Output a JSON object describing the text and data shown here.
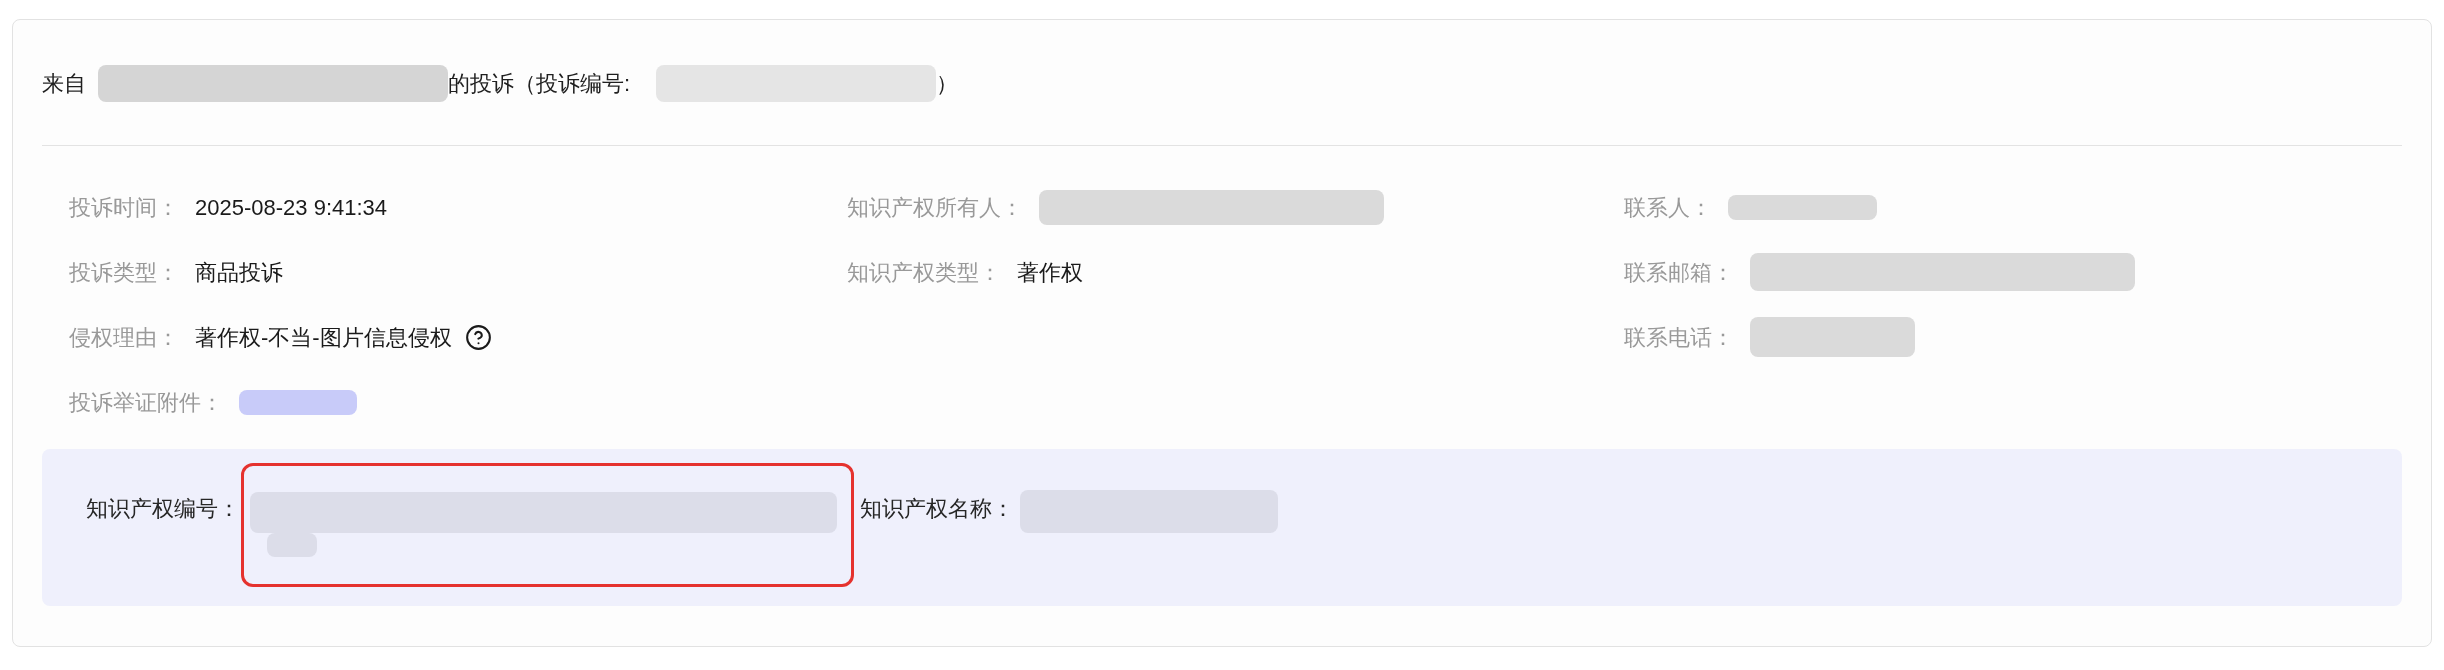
{
  "header": {
    "segments": [
      {
        "kind": "text",
        "text": "来自"
      },
      {
        "kind": "redacted"
      },
      {
        "kind": "text",
        "text": "的投诉（投诉编号:"
      },
      {
        "kind": "redacted"
      },
      {
        "kind": "text",
        "text": "）"
      }
    ]
  },
  "details": {
    "columns": [
      {
        "fields": [
          {
            "label": "投诉时间：",
            "kind": "text",
            "value": "2025-08-23 9:41:34"
          },
          {
            "label": "投诉类型：",
            "kind": "text",
            "value": "商品投诉"
          },
          {
            "label": "侵权理由：",
            "kind": "text",
            "value": "著作权-不当-图片信息侵权",
            "help": true
          },
          {
            "label": "投诉举证附件：",
            "kind": "redacted_link"
          }
        ]
      },
      {
        "fields": [
          {
            "label": "知识产权所有人：",
            "kind": "redacted"
          },
          {
            "label": "知识产权类型：",
            "kind": "text",
            "value": "著作权"
          }
        ]
      },
      {
        "fields": [
          {
            "label": "联系人：",
            "kind": "redacted"
          },
          {
            "label": "联系邮箱：",
            "kind": "redacted"
          },
          {
            "label": "联系电话：",
            "kind": "redacted"
          }
        ]
      }
    ]
  },
  "ip_panel": {
    "fields": [
      {
        "label": "知识产权编号：",
        "kind": "redacted",
        "highlighted": true
      },
      {
        "label": "知识产权名称：",
        "kind": "redacted"
      }
    ]
  }
}
